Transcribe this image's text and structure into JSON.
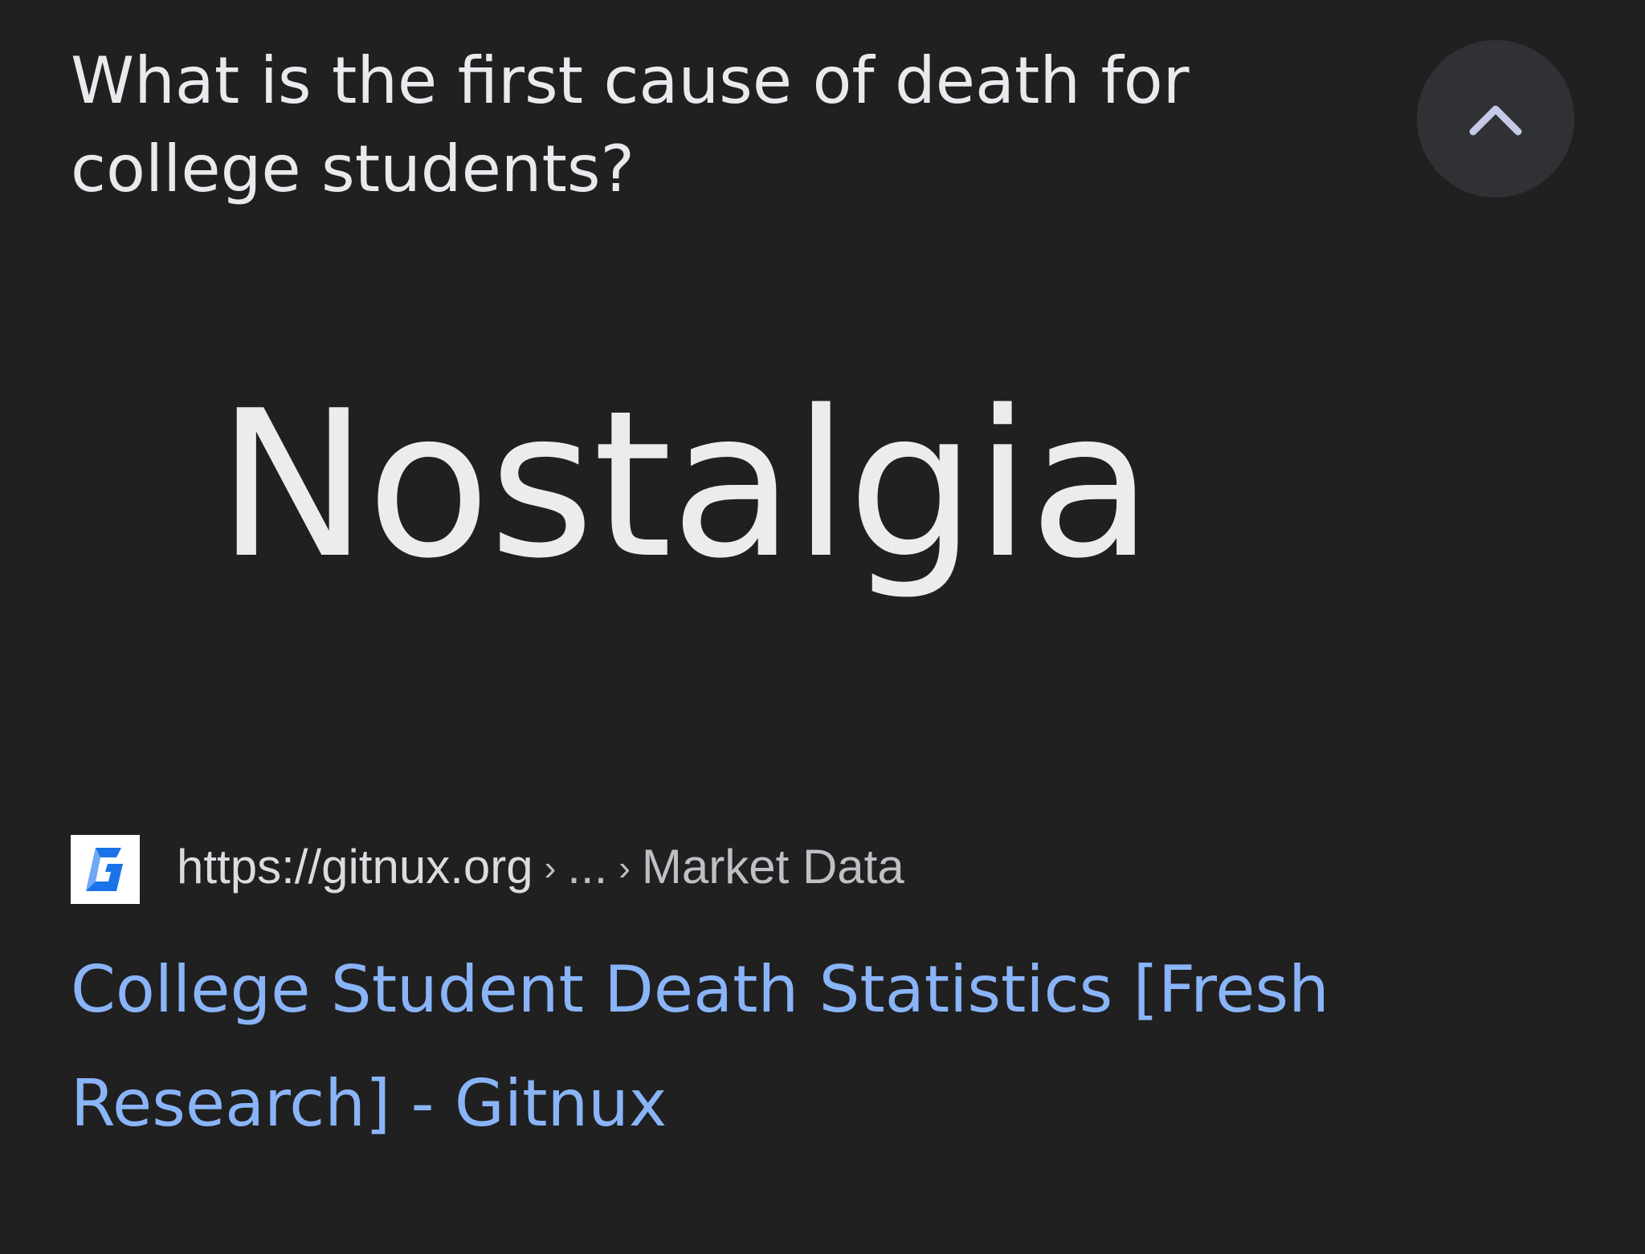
{
  "question": "What is the first cause of death for college students?",
  "collapse_icon": "chevron-up-icon",
  "answer_image_text": "Nostalgia",
  "result": {
    "favicon_icon": "gitnux-logo-icon",
    "url_host": "https://gitnux.org",
    "url_separator": "›",
    "url_ellipsis": "...",
    "url_section": "Market Data",
    "title": "College Student Death Statistics [Fresh Research] - Gitnux"
  },
  "colors": {
    "background": "#202020",
    "question_text": "#e8eaed",
    "link": "#8ab4f8",
    "url_text": "#bdc1c6",
    "button_bg": "#303134",
    "chevron": "#c5cae9",
    "favicon_brand": "#1a73e8"
  }
}
